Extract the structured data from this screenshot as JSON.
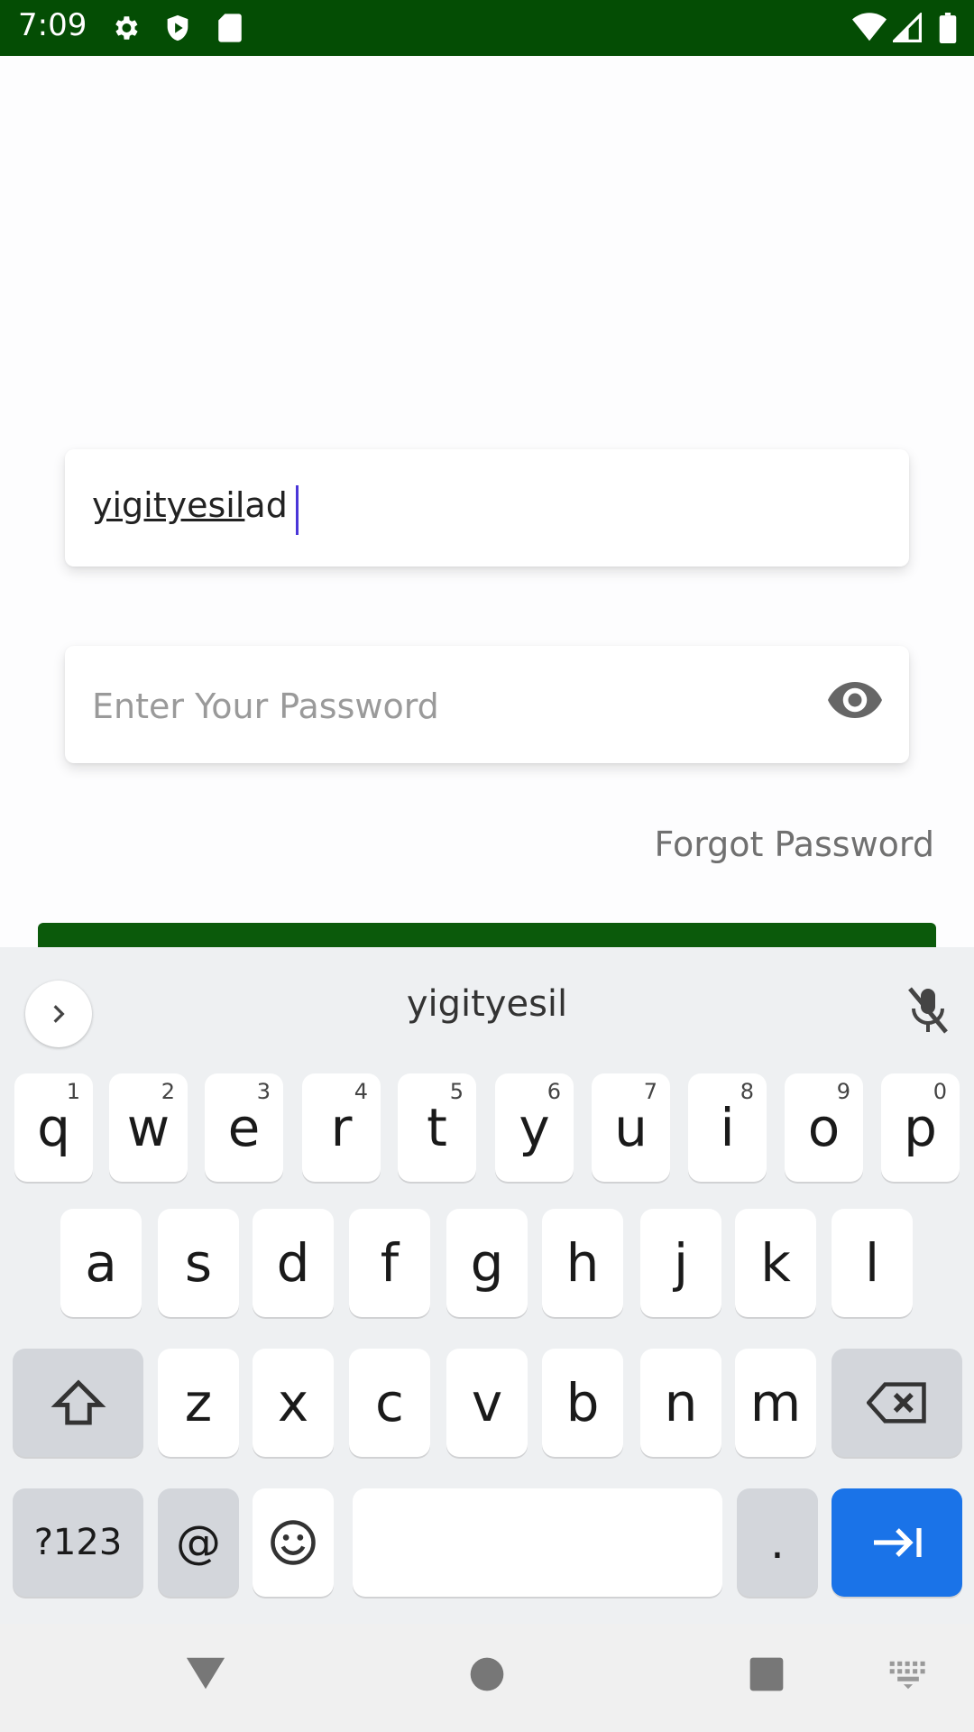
{
  "status_bar": {
    "time": "7:09",
    "background_color": "#044d04",
    "icons": [
      "settings-gear-icon",
      "shield-play-icon",
      "sd-card-icon",
      "wifi-icon",
      "signal-icon",
      "battery-icon"
    ]
  },
  "login_form": {
    "username_value": "yigityesilad",
    "username_underlined_part": "yigityesil",
    "username_remaining_part": "ad",
    "password_placeholder": "Enter Your Password",
    "password_visibility_icon": "eye-icon",
    "forgot_password_label": "Forgot Password",
    "login_button_color": "#0b5a0b"
  },
  "keyboard": {
    "suggestion": "yigityesil",
    "expand_icon": "chevron-right-icon",
    "mic_icon": "mic-off-icon",
    "row1": [
      {
        "letter": "q",
        "hint": "1"
      },
      {
        "letter": "w",
        "hint": "2"
      },
      {
        "letter": "e",
        "hint": "3"
      },
      {
        "letter": "r",
        "hint": "4"
      },
      {
        "letter": "t",
        "hint": "5"
      },
      {
        "letter": "y",
        "hint": "6"
      },
      {
        "letter": "u",
        "hint": "7"
      },
      {
        "letter": "i",
        "hint": "8"
      },
      {
        "letter": "o",
        "hint": "9"
      },
      {
        "letter": "p",
        "hint": "0"
      }
    ],
    "row2": [
      "a",
      "s",
      "d",
      "f",
      "g",
      "h",
      "j",
      "k",
      "l"
    ],
    "row3": [
      "z",
      "x",
      "c",
      "v",
      "b",
      "n",
      "m"
    ],
    "symbols_label": "?123",
    "at_label": "@",
    "period_label": ".",
    "shift_icon": "shift-icon",
    "backspace_icon": "backspace-icon",
    "emoji_icon": "emoji-icon",
    "enter_icon": "tab-next-icon",
    "action_color": "#1a73e8"
  },
  "nav_bar": {
    "icons": [
      "back-triangle-icon",
      "home-circle-icon",
      "recents-square-icon",
      "keyboard-switch-icon"
    ]
  }
}
